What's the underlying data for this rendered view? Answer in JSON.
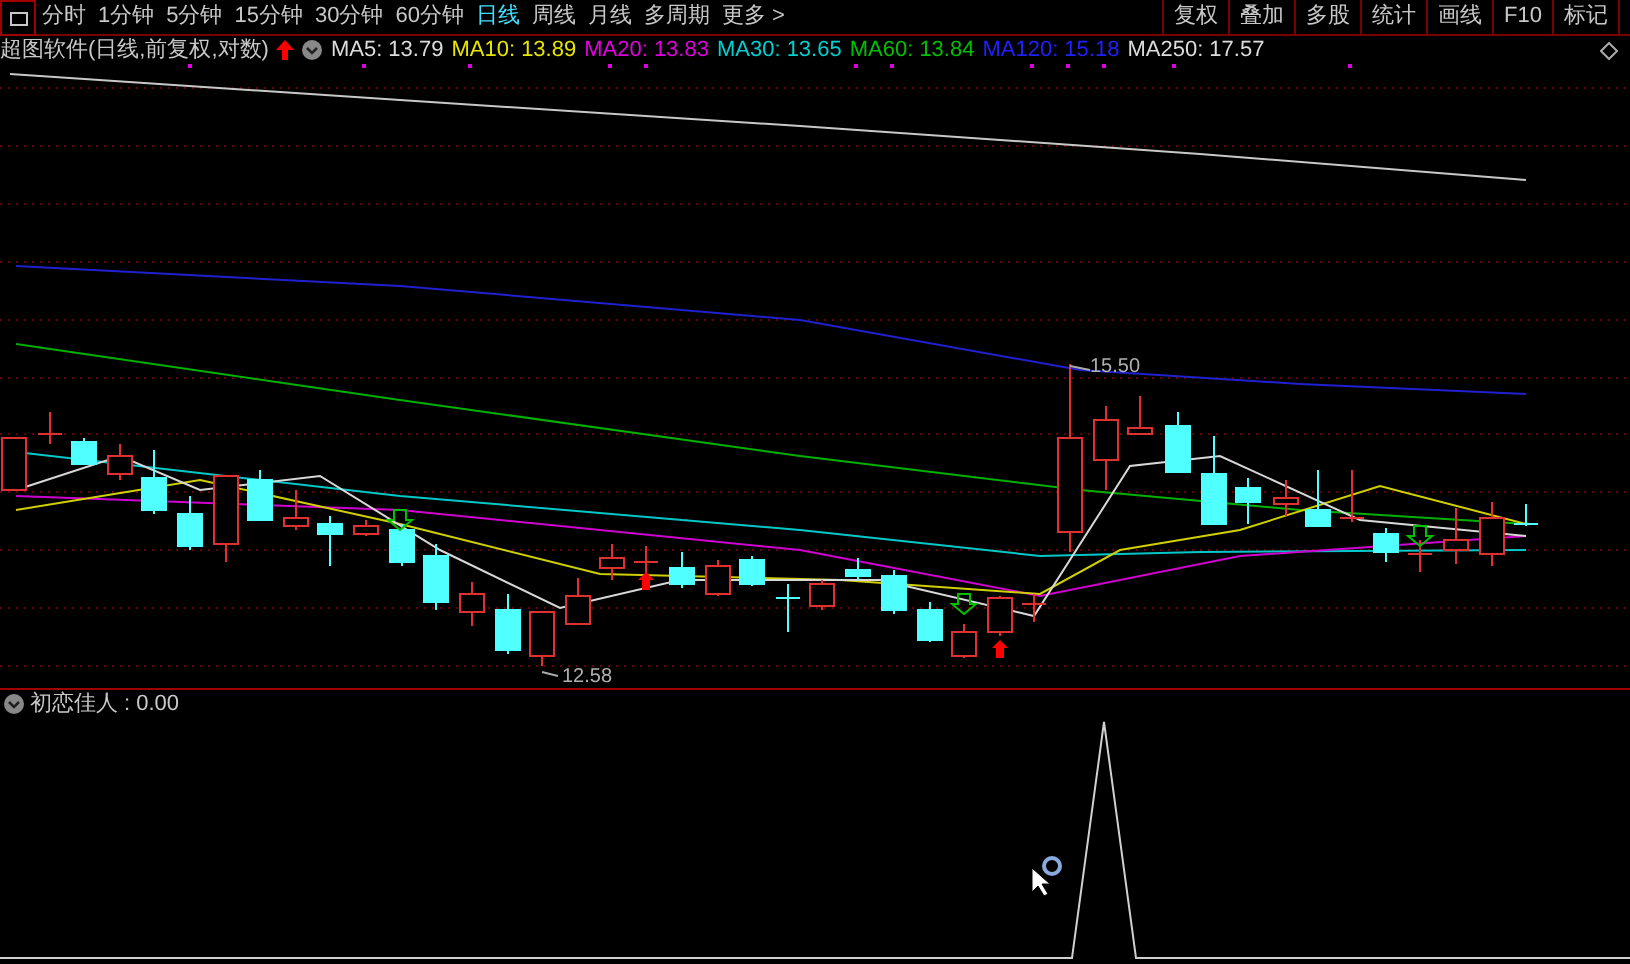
{
  "toolbar": {
    "tabs": [
      {
        "label": "分时",
        "selected": false
      },
      {
        "label": "1分钟",
        "selected": false
      },
      {
        "label": "5分钟",
        "selected": false
      },
      {
        "label": "15分钟",
        "selected": false
      },
      {
        "label": "30分钟",
        "selected": false
      },
      {
        "label": "60分钟",
        "selected": false
      },
      {
        "label": "日线",
        "selected": true
      },
      {
        "label": "周线",
        "selected": false
      },
      {
        "label": "月线",
        "selected": false
      },
      {
        "label": "多周期",
        "selected": false
      }
    ],
    "more": "更多 >",
    "buttons": [
      "复权",
      "叠加",
      "多股",
      "统计",
      "画线",
      "F10",
      "标记"
    ]
  },
  "legend": {
    "title": "超图软件(日线,前复权,对数)",
    "indicators": [
      {
        "label": "MA5: 13.79",
        "color": "#dcdcdc"
      },
      {
        "label": "MA10: 13.89",
        "color": "#e6e600"
      },
      {
        "label": "MA20: 13.83",
        "color": "#e000e0"
      },
      {
        "label": "MA30: 13.65",
        "color": "#00d0d0"
      },
      {
        "label": "MA60: 13.84",
        "color": "#00c000"
      },
      {
        "label": "MA120: 15.18",
        "color": "#2020ff"
      },
      {
        "label": "MA250: 17.57",
        "color": "#dcdcdc"
      }
    ]
  },
  "chart": {
    "high_label": "15.50",
    "low_label": "12.58"
  },
  "sub_chart": {
    "title": "初恋佳人",
    "value": ": 0.00"
  }
}
